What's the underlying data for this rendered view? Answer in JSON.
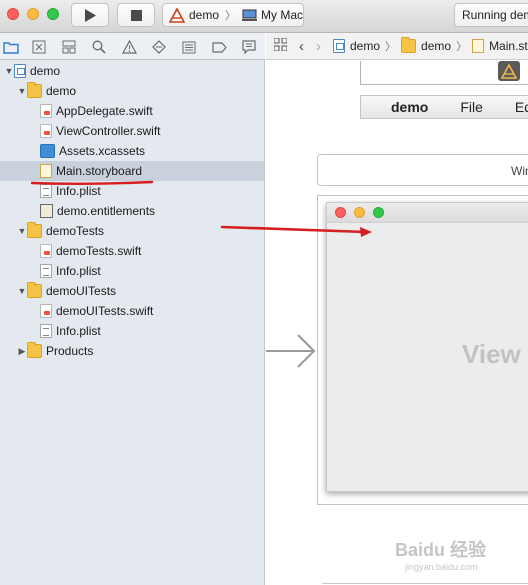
{
  "toolbar": {
    "scheme_target": "demo",
    "device": "My Mac",
    "status": "Running demo"
  },
  "navigator": {
    "tree": [
      {
        "label": "demo",
        "icon": "project-icon",
        "indent": 0,
        "disclosure": "open"
      },
      {
        "label": "demo",
        "icon": "folder-icon",
        "indent": 1,
        "disclosure": "open"
      },
      {
        "label": "AppDelegate.swift",
        "icon": "swift-file-icon",
        "indent": 2
      },
      {
        "label": "ViewController.swift",
        "icon": "swift-file-icon",
        "indent": 2
      },
      {
        "label": "Assets.xcassets",
        "icon": "assets-icon",
        "indent": 2
      },
      {
        "label": "Main.storyboard",
        "icon": "storyboard-icon",
        "indent": 2,
        "selected": true
      },
      {
        "label": "Info.plist",
        "icon": "plist-icon",
        "indent": 2
      },
      {
        "label": "demo.entitlements",
        "icon": "entitlements-icon",
        "indent": 2
      },
      {
        "label": "demoTests",
        "icon": "folder-icon",
        "indent": 1,
        "disclosure": "open"
      },
      {
        "label": "demoTests.swift",
        "icon": "swift-file-icon",
        "indent": 2
      },
      {
        "label": "Info.plist",
        "icon": "plist-icon",
        "indent": 2
      },
      {
        "label": "demoUITests",
        "icon": "folder-icon",
        "indent": 1,
        "disclosure": "open"
      },
      {
        "label": "demoUITests.swift",
        "icon": "swift-file-icon",
        "indent": 2
      },
      {
        "label": "Info.plist",
        "icon": "plist-icon",
        "indent": 2
      },
      {
        "label": "Products",
        "icon": "folder-icon",
        "indent": 1,
        "disclosure": "closed"
      }
    ]
  },
  "jumpbar": {
    "crumbs": [
      "demo",
      "demo",
      "Main.sto"
    ]
  },
  "canvas": {
    "menu": {
      "app": "demo",
      "items": [
        "File",
        "Edit"
      ]
    },
    "window_controller_label": "Win",
    "view_controller_label": "View"
  },
  "watermark": {
    "brand": "Baidu 经验",
    "url": "jingyan.baidu.com"
  },
  "colors": {
    "selection": "#c9d1dd",
    "navigator_bg": "#e4e9f0",
    "annotation_red": "#d61f1f",
    "folder": "#f5c444"
  }
}
